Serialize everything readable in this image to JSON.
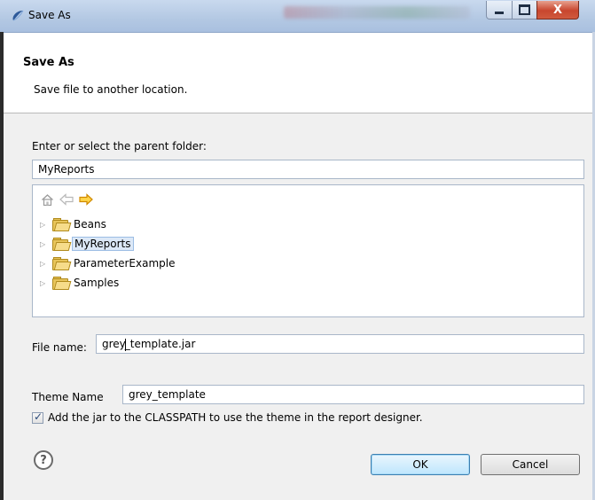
{
  "window": {
    "title": "Save As",
    "close_glyph": "X"
  },
  "banner": {
    "title": "Save As",
    "description": "Save file to another location."
  },
  "parent_folder": {
    "label": "Enter or select the parent folder:",
    "value": "MyReports"
  },
  "tree": {
    "nav_icons": [
      "home-icon",
      "back-arrow-icon",
      "forward-arrow-icon"
    ],
    "items": [
      {
        "label": "Beans",
        "selected": false
      },
      {
        "label": "MyReports",
        "selected": true
      },
      {
        "label": "ParameterExample",
        "selected": false
      },
      {
        "label": "Samples",
        "selected": false
      }
    ]
  },
  "file_name": {
    "label": "File name:",
    "value_before_caret": "grey",
    "value_after_caret": "_template.jar"
  },
  "theme_name": {
    "label": "Theme Name",
    "value": "grey_template"
  },
  "classpath_checkbox": {
    "checked": true,
    "label": "Add the jar to the CLASSPATH to use the theme in the report designer."
  },
  "buttons": {
    "ok": "OK",
    "cancel": "Cancel",
    "help_glyph": "?"
  },
  "colors": {
    "titlebar": "#b3c8e3",
    "close_button": "#c8462e",
    "ok_border": "#3c7fb1",
    "folder": "#e7c45a",
    "selection": "#dce8f7"
  }
}
